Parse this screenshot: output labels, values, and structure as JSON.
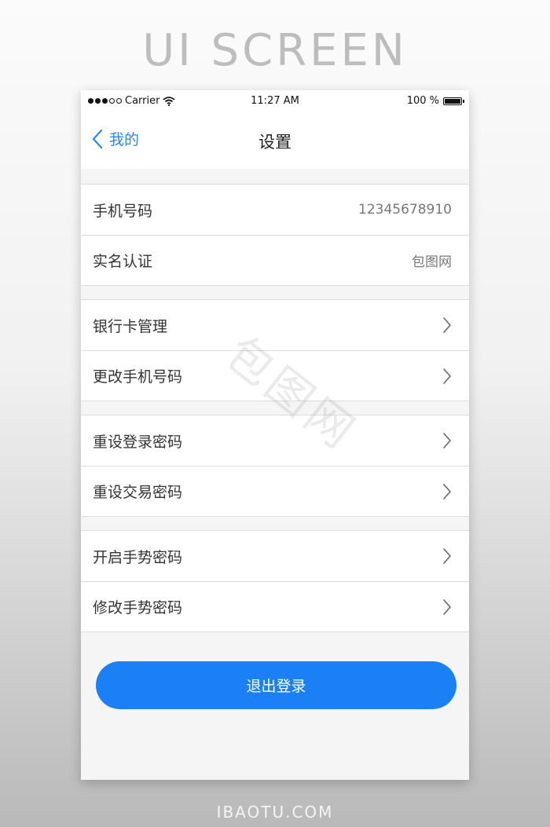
{
  "banner": {
    "title": "UI SCREEN"
  },
  "footer": {
    "brand": "IBAOTU.COM"
  },
  "status_bar": {
    "carrier": "Carrier",
    "time": "11:27 AM",
    "battery": "100 %",
    "signal_icon": "signal-dots-icon",
    "wifi_icon": "wifi-icon",
    "battery_icon": "battery-icon"
  },
  "nav": {
    "back_label": "我的",
    "back_icon": "chevron-left-icon",
    "title": "设置"
  },
  "groups": [
    {
      "rows": [
        {
          "label": "手机号码",
          "value": "12345678910"
        },
        {
          "label": "实名认证",
          "value": "包图网"
        }
      ]
    },
    {
      "rows": [
        {
          "label": "银行卡管理"
        },
        {
          "label": "更改手机号码"
        }
      ]
    },
    {
      "rows": [
        {
          "label": "重设登录密码"
        },
        {
          "label": "重设交易密码"
        }
      ]
    },
    {
      "rows": [
        {
          "label": "开启手势密码"
        },
        {
          "label": "修改手势密码"
        }
      ]
    }
  ],
  "logout": {
    "label": "退出登录"
  },
  "watermark": "包图网",
  "colors": {
    "accent": "#1b7ff6",
    "link": "#2d86f3",
    "background": "#f5f5f5"
  }
}
